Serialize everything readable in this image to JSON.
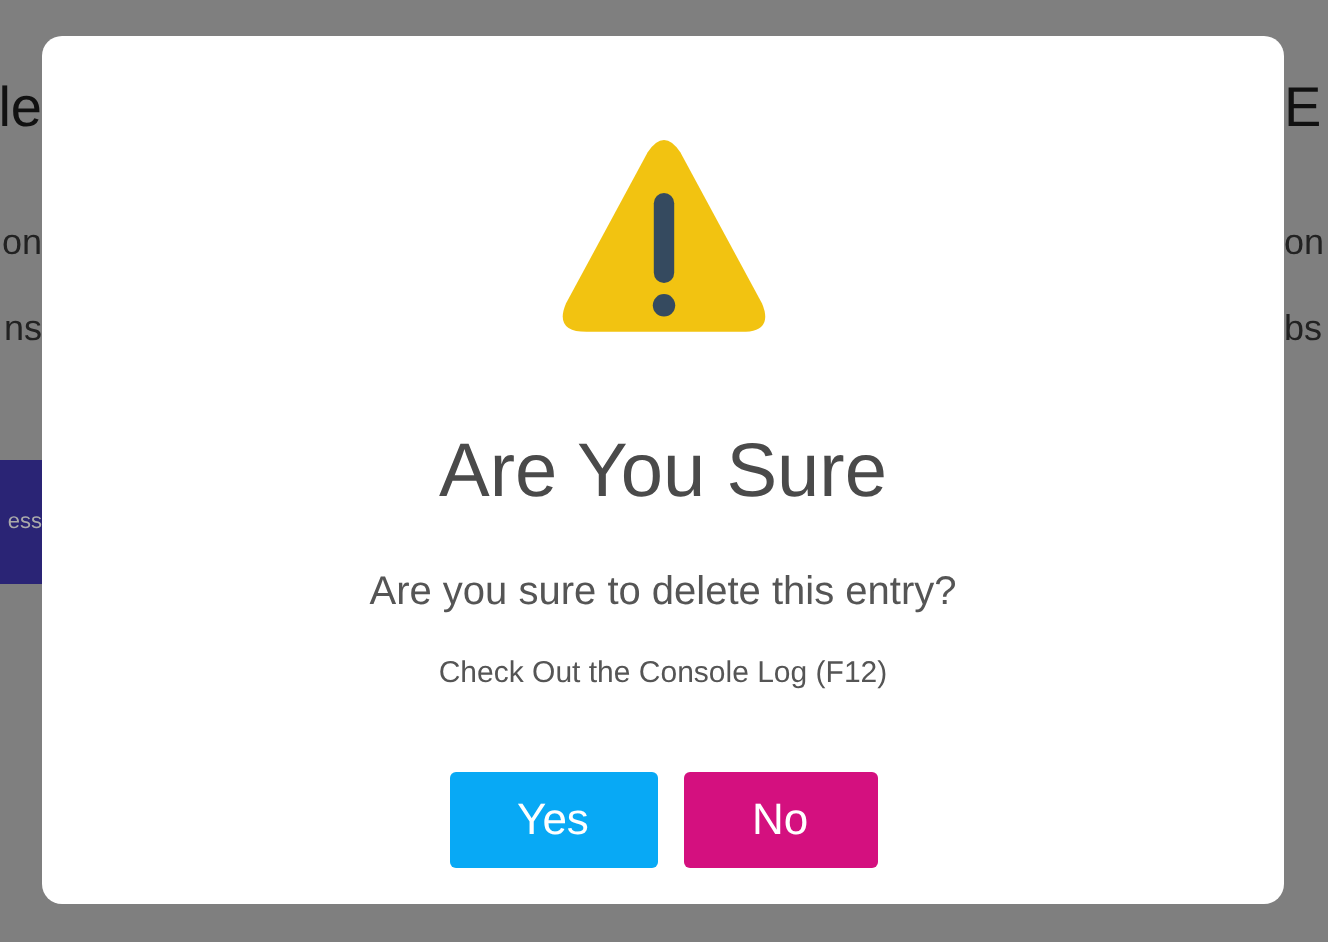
{
  "background": {
    "left": {
      "heading": "le",
      "lines": [
        "on",
        "ns"
      ],
      "button": "ess"
    },
    "right": {
      "heading": "E",
      "lines": [
        "on",
        "bs"
      ]
    }
  },
  "dialog": {
    "title": "Are You Sure",
    "message": "Are you sure to delete this entry?",
    "note": "Check Out the Console Log (F12)",
    "buttons": [
      {
        "label": "Yes",
        "kind": "confirm"
      },
      {
        "label": "No",
        "kind": "cancel"
      }
    ]
  }
}
